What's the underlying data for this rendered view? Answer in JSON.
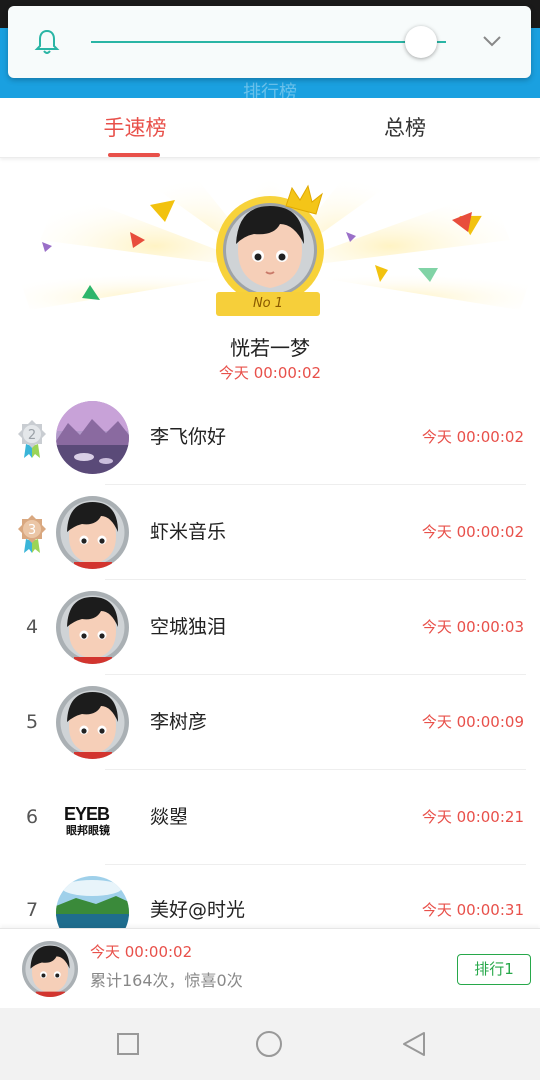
{
  "app": {
    "title": "排行榜"
  },
  "tabs": [
    {
      "label": "手速榜",
      "active": true
    },
    {
      "label": "总榜",
      "active": false
    }
  ],
  "volume": {
    "level": 0.93
  },
  "champion": {
    "badge": "No 1",
    "name": "恍若一梦",
    "time": "今天 00:00:02",
    "avatar": "cartoon-boy-avatar"
  },
  "ranking": [
    {
      "rank": "2",
      "name": "李飞你好",
      "time": "今天 00:00:02",
      "avatar": "landscape-photo",
      "medal": "silver"
    },
    {
      "rank": "3",
      "name": "虾米音乐",
      "time": "今天 00:00:02",
      "avatar": "cartoon-boy-avatar",
      "medal": "bronze"
    },
    {
      "rank": "4",
      "name": "空城独泪",
      "time": "今天 00:00:03",
      "avatar": "cartoon-boy-avatar"
    },
    {
      "rank": "5",
      "name": "李树彦",
      "time": "今天 00:00:09",
      "avatar": "cartoon-boy-avatar"
    },
    {
      "rank": "6",
      "name": "燚曌",
      "time": "今天 00:00:21",
      "avatar": "eyeglass-store-logo",
      "logo_top": "EYEB",
      "logo_bottom": "眼邦眼镜"
    },
    {
      "rank": "7",
      "name": "美好@时光",
      "time": "今天 00:00:31",
      "avatar": "lake-photo"
    }
  ],
  "me": {
    "time": "今天 00:00:02",
    "stats": "累计164次，惊喜0次",
    "rank_button": "排行1"
  },
  "colors": {
    "accent": "#e8504a",
    "green": "#27a84a",
    "appbar": "#1aa0e0",
    "slider": "#2ab5a5"
  }
}
